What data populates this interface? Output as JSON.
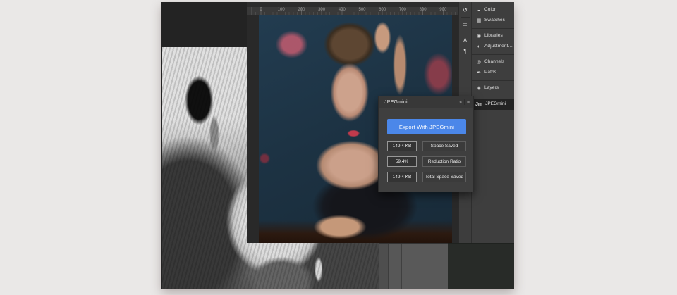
{
  "colors": {
    "accent": "#4b87e9",
    "page_bg": "#eae8e7"
  },
  "ruler": {
    "marks": [
      "0",
      "100",
      "200",
      "300",
      "400",
      "500",
      "600",
      "700",
      "800",
      "900"
    ]
  },
  "tool_dock": {
    "items": [
      {
        "name": "history-icon",
        "glyph": "↺"
      },
      {
        "name": "brush-settings-icon",
        "glyph": "≣"
      },
      {
        "name": "character-icon",
        "glyph": "A"
      },
      {
        "name": "paragraph-icon",
        "glyph": "¶"
      }
    ]
  },
  "panel_dock": {
    "groups": [
      [
        {
          "label": "Color",
          "glyph": "◒"
        },
        {
          "label": "Swatches",
          "glyph": "▦"
        }
      ],
      [
        {
          "label": "Libraries",
          "glyph": "◉"
        },
        {
          "label": "Adjustment…",
          "glyph": "◐"
        }
      ],
      [
        {
          "label": "Channels",
          "glyph": "◎"
        },
        {
          "label": "Paths",
          "glyph": "✒"
        }
      ],
      [
        {
          "label": "Layers",
          "glyph": "◈"
        }
      ]
    ],
    "jpegmini": {
      "logo": "Jm",
      "label": "JPEGmini"
    }
  },
  "jpegmini_panel": {
    "title": "JPEGmini",
    "collapse_icon": "»",
    "menu_icon": "≡",
    "export_button": "Export With JPEGmini",
    "stats": [
      {
        "value": "149.4 KB",
        "label": "Space Saved"
      },
      {
        "value": "59.4%",
        "label": "Reduction Ratio"
      },
      {
        "value": "149.4 KB",
        "label": "Total Space Saved"
      }
    ]
  }
}
